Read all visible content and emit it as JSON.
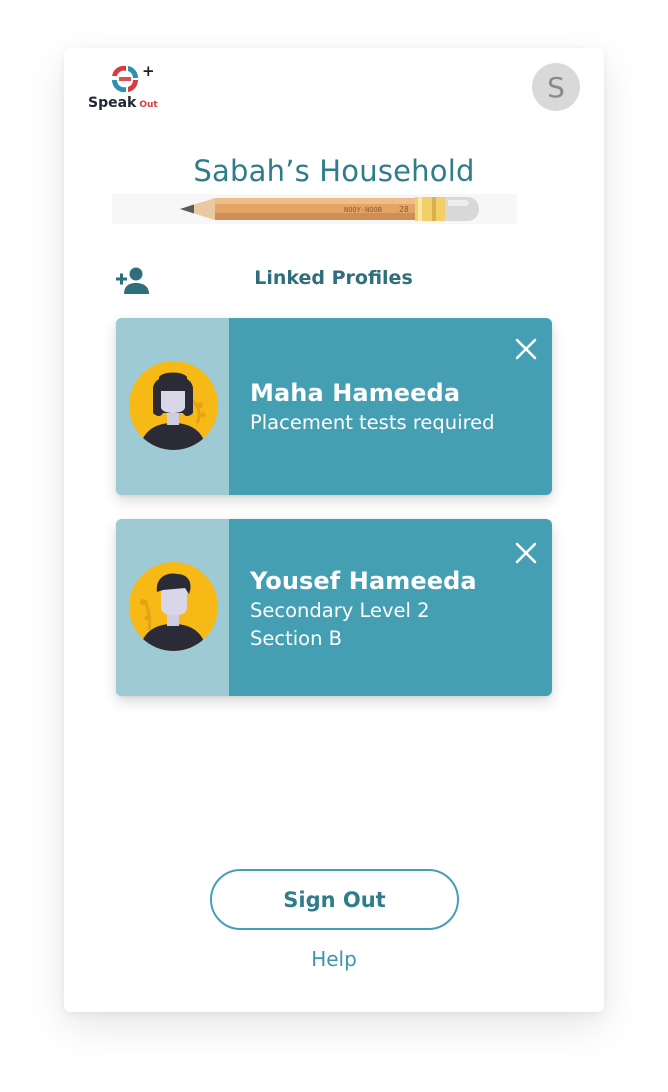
{
  "logo": {
    "speak": "Speak",
    "out": "Out",
    "plus": "+"
  },
  "user": {
    "initial": "S"
  },
  "household": {
    "title": "Sabah’s Household"
  },
  "pencil": {
    "text": "NOOY-NOOB",
    "number": "28"
  },
  "linked": {
    "label": "Linked Profiles"
  },
  "profiles": [
    {
      "name": "Maha Hameeda",
      "lines": [
        "Placement tests required"
      ]
    },
    {
      "name": "Yousef Hameeda",
      "lines": [
        "Secondary Level 2",
        "Section B"
      ]
    }
  ],
  "actions": {
    "sign_out": "Sign Out",
    "help": "Help"
  },
  "colors": {
    "accent": "#449fb3",
    "accent_light": "#9ecad6",
    "title": "#2f7d8a",
    "avatar_bg": "#f6b916",
    "brand_red": "#d93a3e"
  },
  "icons": {
    "add_user": "add-user-icon",
    "close": "close-icon",
    "pencil": "pencil-illustration"
  }
}
